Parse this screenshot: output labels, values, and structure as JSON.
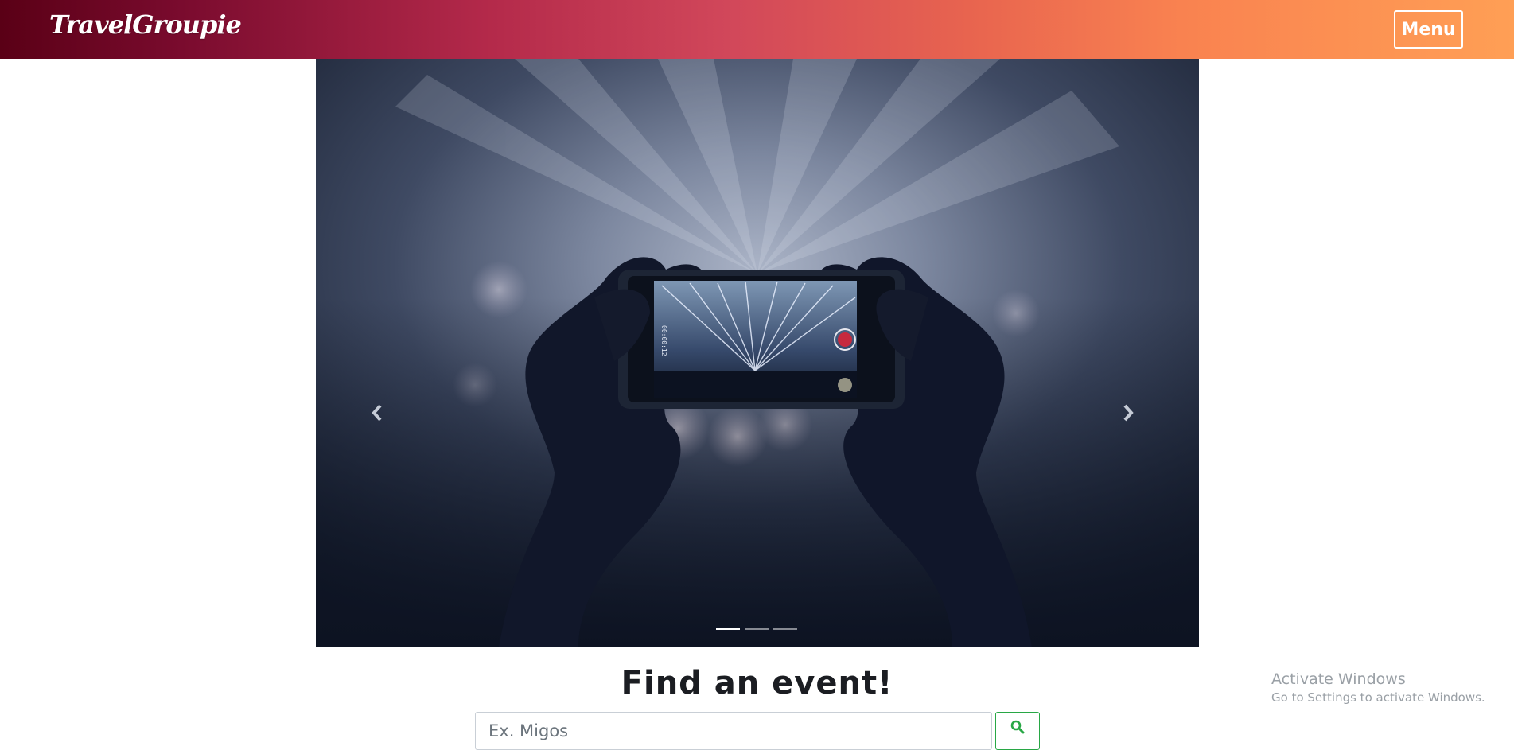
{
  "navbar": {
    "brand": "TravelGroupie",
    "menu_label": "Menu"
  },
  "carousel": {
    "slide_count": 3,
    "active_index": 0,
    "image_description": "Concert crowd silhouette hands holding a smartphone recording a stage light show",
    "phone_timer": "00:00:12"
  },
  "search": {
    "heading": "Find an event!",
    "placeholder": "Ex. Migos",
    "value": "",
    "button_icon": "search-icon"
  },
  "watermark": {
    "title": "Activate Windows",
    "subtitle": "Go to Settings to activate Windows."
  },
  "colors": {
    "nav_gradient_start": "#5a0016",
    "nav_gradient_mid": "#d1475a",
    "nav_gradient_end": "#ff9f55",
    "search_button_accent": "#28a745",
    "heading_text": "#1b1d22"
  }
}
